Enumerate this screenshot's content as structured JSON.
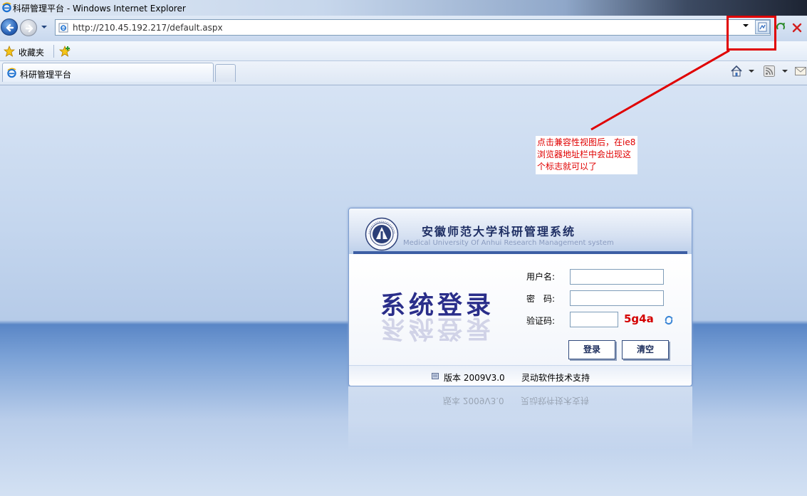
{
  "window": {
    "title": "科研管理平台 - Windows Internet Explorer"
  },
  "address_bar": {
    "url": "http://210.45.192.217/default.aspx"
  },
  "favorites_bar": {
    "label": "收藏夹"
  },
  "tabs": [
    {
      "label": "科研管理平台",
      "active": true
    }
  ],
  "annotation": {
    "text": "点击兼容性视图后，在ie8浏览器地址栏中会出现这个标志就可以了",
    "color": "#e00000"
  },
  "login_panel": {
    "title": "安徽师范大学科研管理系统",
    "subtitle": "Medical University Of Anhui Research Management system",
    "big_title": "系统登录",
    "username_label": "用户名:",
    "password_label": "密　码:",
    "captcha_label": "验证码:",
    "username_value": "",
    "password_value": "",
    "captcha_value": "",
    "captcha_code": "5g4a",
    "login_button": "登录",
    "clear_button": "清空",
    "version_text": "版本 2009V3.0",
    "support_text": "灵动软件技术支持"
  },
  "colors": {
    "accent": "#3d5fa4",
    "captcha": "#d40000"
  }
}
